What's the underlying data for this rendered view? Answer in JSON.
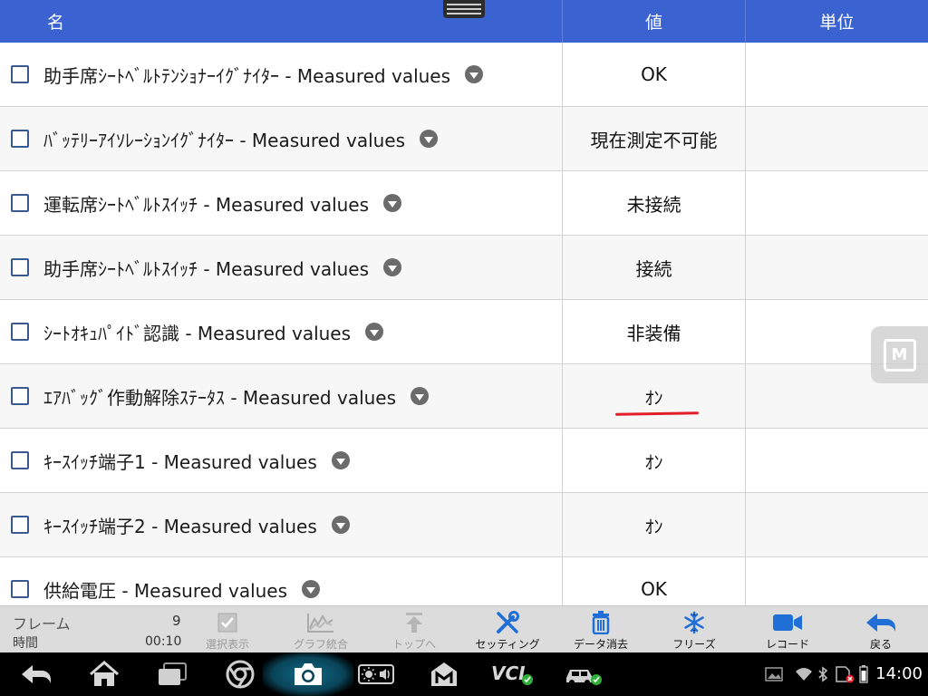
{
  "header": {
    "col_name": "名",
    "col_value": "値",
    "col_unit": "単位"
  },
  "rows": [
    {
      "label": "助手席ｼｰﾄﾍﾞﾙﾄﾃﾝｼｮﾅｰｲｸﾞﾅｲﾀｰ - Measured values",
      "value": "OK",
      "unit": ""
    },
    {
      "label": "ﾊﾞｯﾃﾘｰｱｲｿﾚｰｼｮﾝｲｸﾞﾅｲﾀｰ - Measured values",
      "value": "現在測定不可能",
      "unit": ""
    },
    {
      "label": "運転席ｼｰﾄﾍﾞﾙﾄｽｲｯﾁ - Measured values",
      "value": "未接続",
      "unit": ""
    },
    {
      "label": "助手席ｼｰﾄﾍﾞﾙﾄｽｲｯﾁ - Measured values",
      "value": "接続",
      "unit": ""
    },
    {
      "label": "ｼｰﾄｵｷｭﾊﾟｲﾄﾞ認識 - Measured values",
      "value": "非装備",
      "unit": ""
    },
    {
      "label": "ｴｱﾊﾞｯｸﾞ作動解除ｽﾃｰﾀｽ - Measured values",
      "value": "ｵﾝ",
      "unit": ""
    },
    {
      "label": "ｷｰｽｲｯﾁ端子1 - Measured values",
      "value": "ｵﾝ",
      "unit": ""
    },
    {
      "label": "ｷｰｽｲｯﾁ端子2 - Measured values",
      "value": "ｵﾝ",
      "unit": ""
    },
    {
      "label": "供給電圧 - Measured values",
      "value": "OK",
      "unit": ""
    }
  ],
  "toolbar": {
    "frame_label": "フレーム",
    "frame_value": "9",
    "time_label": "時間",
    "time_value": "00:10",
    "select_label": "選択表示",
    "graph_label": "グラフ統合",
    "top_label": "トップへ",
    "setting_label": "セッティング",
    "delete_label": "データ消去",
    "freeze_label": "フリーズ",
    "record_label": "レコード",
    "back_label": "戻る"
  },
  "status": {
    "time": "14:00"
  },
  "colors": {
    "header_bg": "#3a63d1",
    "accent_blue": "#1f6fd6",
    "highlight_red": "#e21e2a"
  }
}
